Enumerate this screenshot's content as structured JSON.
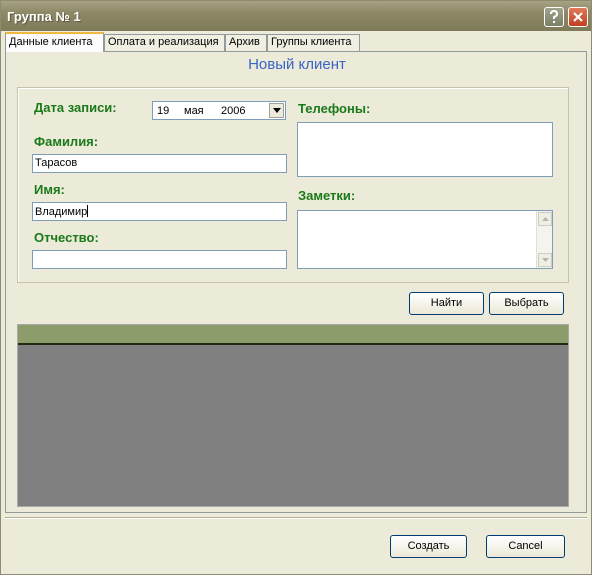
{
  "window": {
    "title": "Группа № 1"
  },
  "tabs": [
    {
      "label": "Данные клиента",
      "active": true
    },
    {
      "label": "Оплата и реализация",
      "active": false
    },
    {
      "label": "Архив",
      "active": false
    },
    {
      "label": "Группы клиента",
      "active": false
    }
  ],
  "form": {
    "heading": "Новый клиент",
    "date_label": "Дата записи:",
    "date": {
      "day": "19",
      "month": "мая",
      "year": "2006"
    },
    "surname_label": "Фамилия:",
    "surname_value": "Тарасов",
    "name_label": "Имя:",
    "name_value": "Владимир",
    "patronymic_label": "Отчество:",
    "patronymic_value": "",
    "phones_label": "Телефоны:",
    "notes_label": "Заметки:"
  },
  "search": {
    "find_label": "Найти",
    "select_label": "Выбрать"
  },
  "footer": {
    "create_label": "Создать",
    "cancel_label": "Cancel"
  },
  "colors": {
    "label_green": "#1a7a1a",
    "heading_blue": "#3a64c8",
    "grid_header": "#8c9c6a",
    "grid_body": "#808080"
  },
  "icons": [
    "help-icon",
    "close-icon",
    "dropdown-arrow-icon",
    "scroll-up-icon",
    "scroll-down-icon"
  ]
}
